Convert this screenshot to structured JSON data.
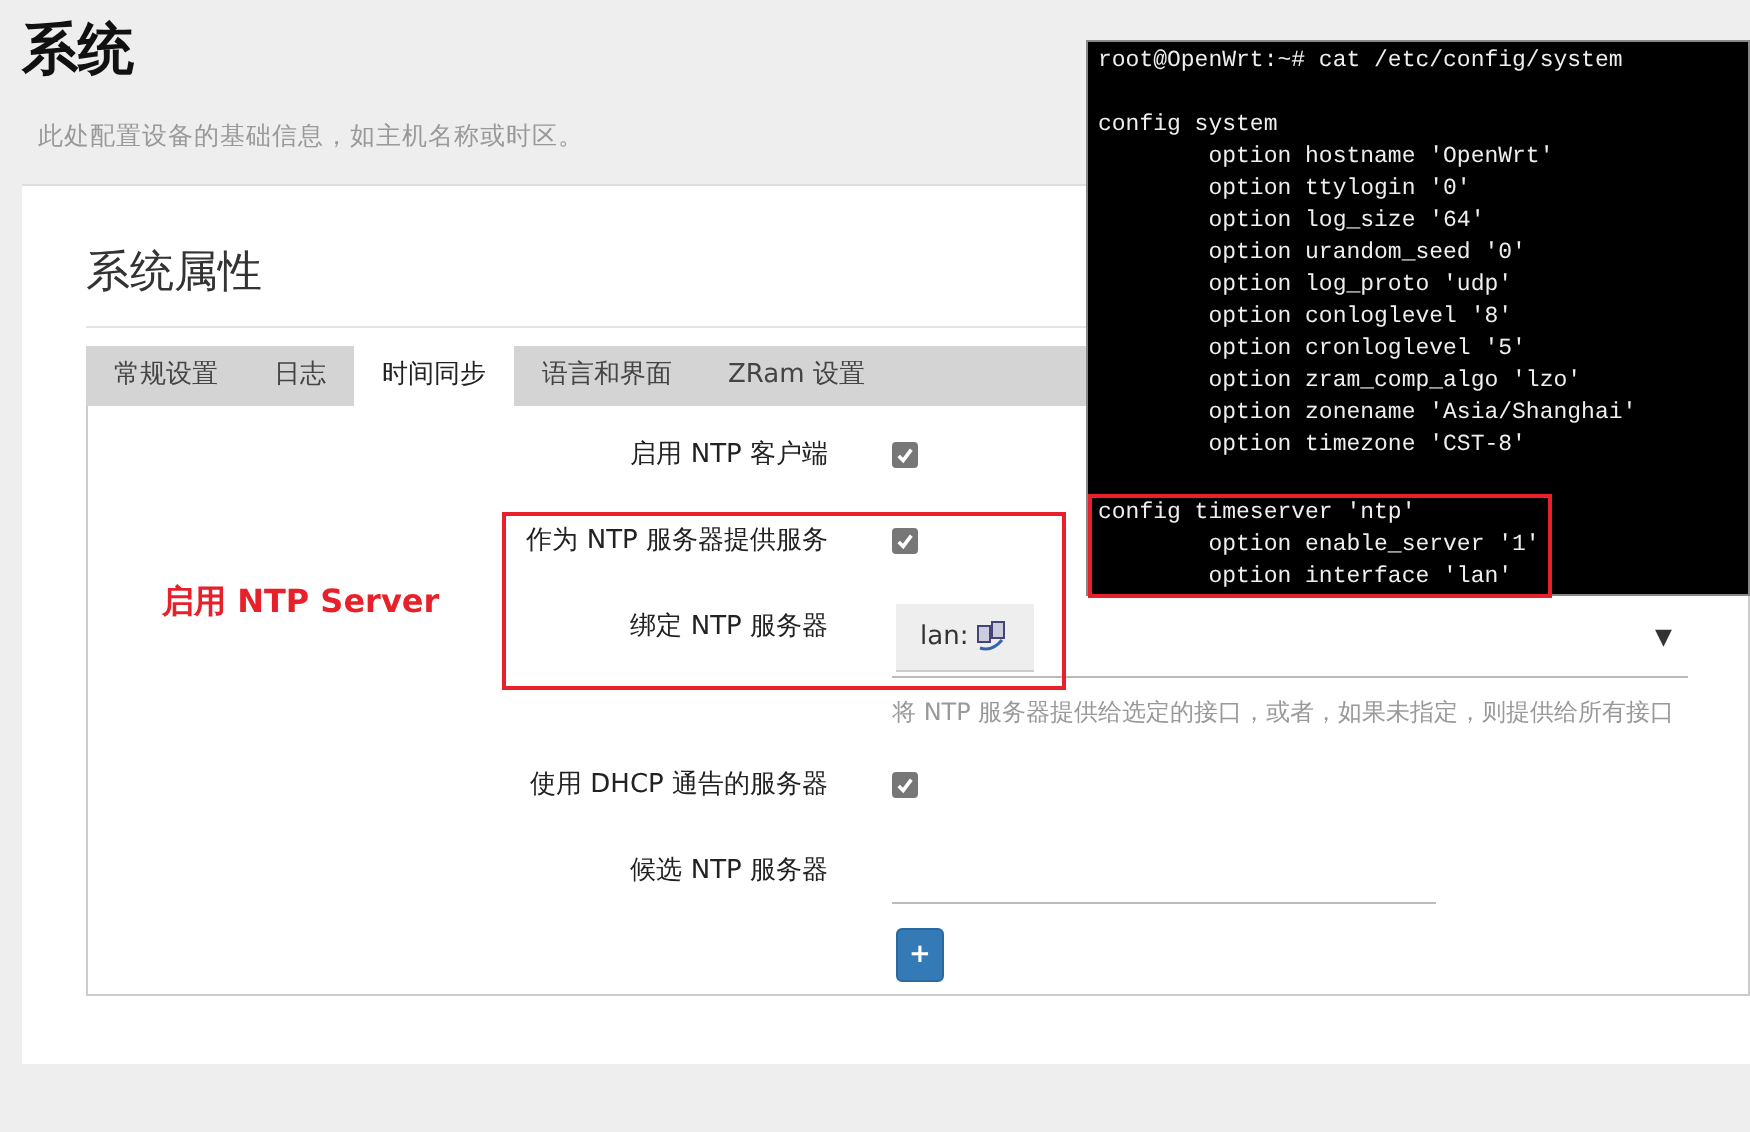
{
  "page": {
    "title": "系统",
    "description": "此处配置设备的基础信息，如主机名称或时区。"
  },
  "section": {
    "title": "系统属性"
  },
  "tabs": [
    {
      "label": "常规设置",
      "selected": false
    },
    {
      "label": "日志",
      "selected": false
    },
    {
      "label": "时间同步",
      "selected": true
    },
    {
      "label": "语言和界面",
      "selected": false
    },
    {
      "label": "ZRam 设置",
      "selected": false
    }
  ],
  "fields": [
    {
      "kind": "checkbox",
      "label": "启用 NTP 客户端",
      "checked": true
    },
    {
      "kind": "checkbox",
      "label": "作为 NTP 服务器提供服务",
      "checked": true
    },
    {
      "kind": "select",
      "label": "绑定 NTP 服务器",
      "value": "lan:",
      "caret": "▼",
      "help": "将 NTP 服务器提供给选定的接口，或者，如果未指定，则提供给所有接口"
    },
    {
      "kind": "checkbox",
      "label": "使用 DHCP 通告的服务器",
      "checked": true
    },
    {
      "kind": "text",
      "label": "候选 NTP 服务器",
      "add_button": "+"
    }
  ],
  "annotation": {
    "text": "启用 NTP Server"
  },
  "terminal": {
    "blocks": [
      {
        "highlighted": false,
        "lines": [
          "root@OpenWrt:~# cat /etc/config/system"
        ]
      },
      {
        "highlighted": false,
        "lines": [
          "config system",
          "        option hostname 'OpenWrt'",
          "        option ttylogin '0'",
          "        option log_size '64'",
          "        option urandom_seed '0'",
          "        option log_proto 'udp'",
          "        option conloglevel '8'",
          "        option cronloglevel '5'",
          "        option zram_comp_algo 'lzo'",
          "        option zonename 'Asia/Shanghai'",
          "        option timezone 'CST-8'"
        ]
      },
      {
        "highlighted": true,
        "lines": [
          "config timeserver 'ntp'",
          "        option enable_server '1'",
          "        option interface 'lan'"
        ]
      }
    ]
  }
}
